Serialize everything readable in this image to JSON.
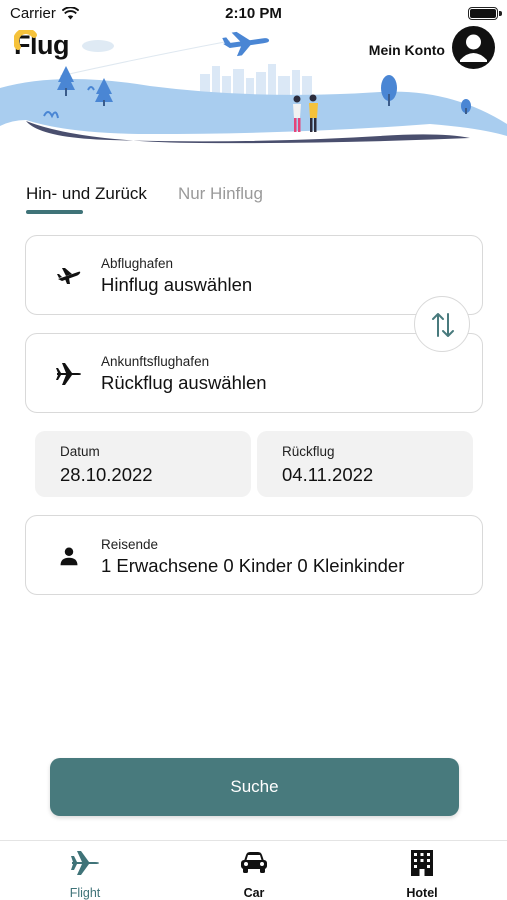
{
  "status_bar": {
    "carrier": "Carrier",
    "time": "2:10 PM",
    "icons": [
      "wifi-icon",
      "battery-icon"
    ]
  },
  "header": {
    "logo": "Flug",
    "account_label": "Mein Konto",
    "icons": [
      "avatar-icon",
      "airplane-illustration"
    ]
  },
  "trip_tabs": [
    {
      "label": "Hin- und Zurück",
      "active": true
    },
    {
      "label": "Nur Hinflug",
      "active": false
    }
  ],
  "departure": {
    "label": "Abflughafen",
    "value": "Hinflug auswählen",
    "icon": "takeoff-icon"
  },
  "arrival": {
    "label": "Ankunftsflughafen",
    "value": "Rückflug auswählen",
    "icon": "airplane-icon"
  },
  "swap_icon": "swap-icon",
  "dates": {
    "departure": {
      "label": "Datum",
      "value": "28.10.2022"
    },
    "return": {
      "label": "Rückflug",
      "value": "04.11.2022"
    }
  },
  "travellers": {
    "label": "Reisende",
    "value": "1 Erwachsene 0 Kinder 0 Kleinkinder",
    "icon": "person-icon"
  },
  "search_button": {
    "label": "Suche"
  },
  "tabbar": [
    {
      "label": "Flight",
      "icon": "airplane-icon",
      "active": true
    },
    {
      "label": "Car",
      "icon": "car-icon",
      "active": false
    },
    {
      "label": "Hotel",
      "icon": "building-icon",
      "active": false
    }
  ],
  "colors": {
    "accent": "#487a7d",
    "tab_active": "#3f7378",
    "inactive_text": "#9a9a9a",
    "hero_blue": "#a9cdef"
  }
}
